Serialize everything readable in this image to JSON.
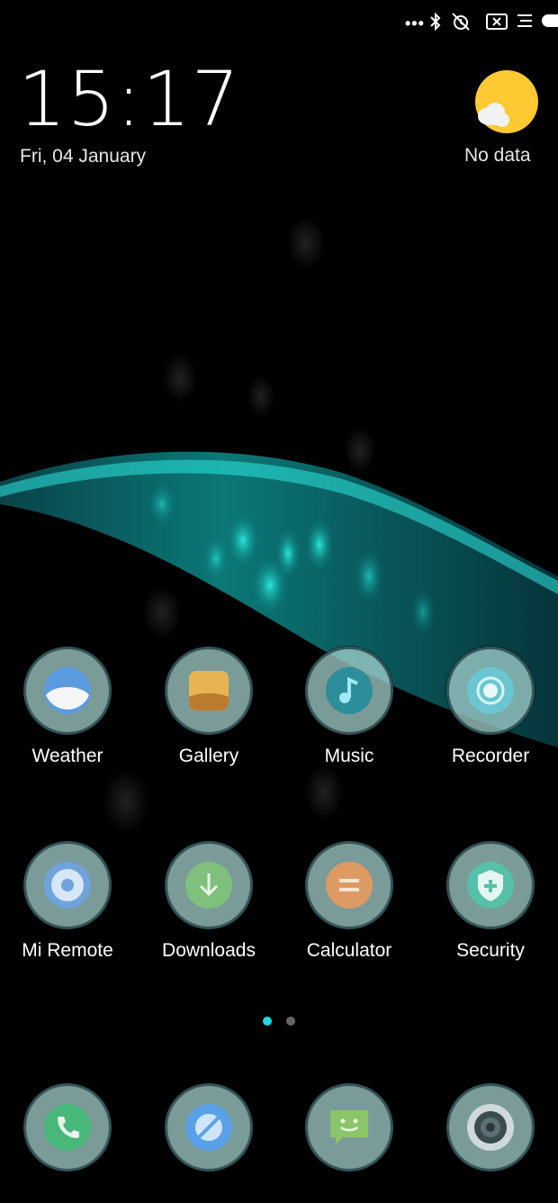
{
  "status_bar": {
    "icons": [
      "more-dots-icon",
      "bluetooth-icon",
      "alarm-off-icon",
      "no-sim-icon",
      "menu-icon",
      "battery-icon"
    ]
  },
  "clock": {
    "time": "15:17",
    "date": "Fri, 04 January"
  },
  "weather_widget": {
    "text": "No data",
    "icon": "partly-cloudy-sun-icon"
  },
  "apps_row1": [
    {
      "label": "Weather",
      "icon": "weather-icon"
    },
    {
      "label": "Gallery",
      "icon": "gallery-icon"
    },
    {
      "label": "Music",
      "icon": "music-icon"
    },
    {
      "label": "Recorder",
      "icon": "recorder-icon"
    }
  ],
  "apps_row2": [
    {
      "label": "Mi Remote",
      "icon": "remote-icon"
    },
    {
      "label": "Downloads",
      "icon": "download-icon"
    },
    {
      "label": "Calculator",
      "icon": "calculator-icon"
    },
    {
      "label": "Security",
      "icon": "security-shield-icon"
    }
  ],
  "page_indicator": {
    "current": 1,
    "total": 2,
    "active_color": "#1fd6e6",
    "inactive_color": "#666666"
  },
  "dock": [
    {
      "icon": "phone-icon"
    },
    {
      "icon": "browser-icon"
    },
    {
      "icon": "messaging-icon"
    },
    {
      "icon": "camera-icon"
    }
  ],
  "colors": {
    "accent": "#1fd6e6",
    "sun": "#ffc933"
  }
}
